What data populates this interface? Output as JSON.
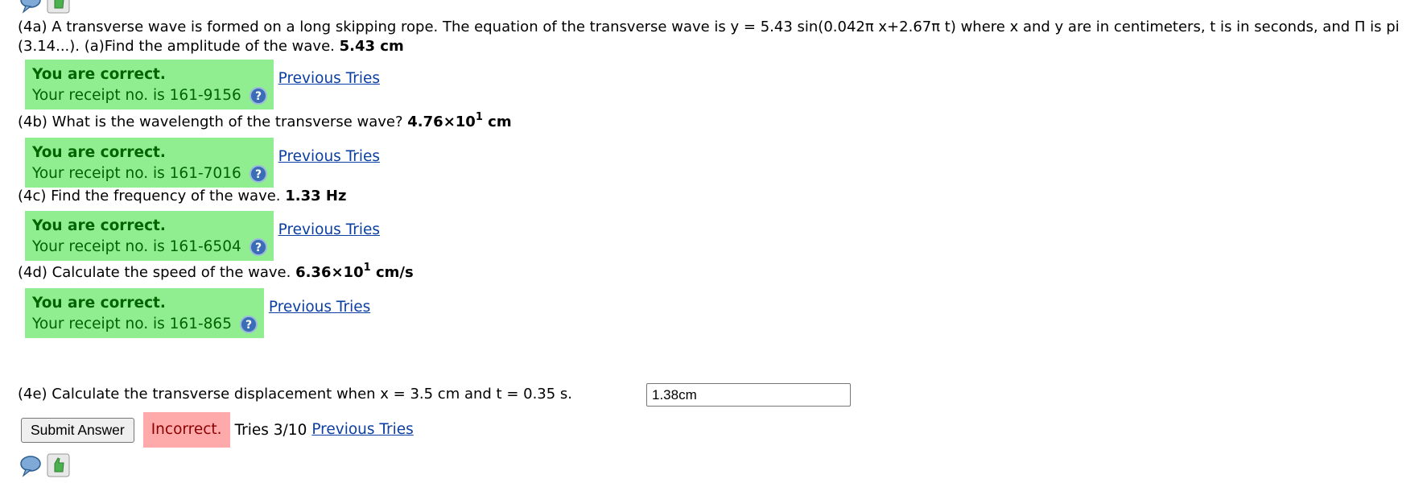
{
  "colors": {
    "correct_bg": "#90ee90",
    "correct_text": "#006400",
    "incorrect_bg": "#ffaaaa",
    "incorrect_text": "#8b0000",
    "link": "#0b3fa3"
  },
  "icons": {
    "discussion": "speech-bubble-icon",
    "feedback": "thumbs-up-icon",
    "help": "help-question-icon"
  },
  "q4a": {
    "text": "(4a) A transverse wave is formed on a long skipping rope. The equation of the transverse wave is y = 5.43 sin(0.042π x+2.67π t) where x and y are in centimeters, t is in seconds, and Π is pi (3.14...). (a)Find the amplitude of the wave.",
    "answer": "5.43 cm",
    "status_title": "You are correct.",
    "receipt": "Your receipt no. is 161-9156",
    "prev_tries": "Previous Tries"
  },
  "q4b": {
    "text": "(4b) What is the wavelength of the transverse wave?",
    "answer_mantissa": "4.76×10",
    "answer_exp": "1",
    "answer_unit": "cm",
    "status_title": "You are correct.",
    "receipt": "Your receipt no. is 161-7016",
    "prev_tries": "Previous Tries"
  },
  "q4c": {
    "text": "(4c) Find the frequency of the wave.",
    "answer": "1.33 Hz",
    "status_title": "You are correct.",
    "receipt": "Your receipt no. is 161-6504",
    "prev_tries": "Previous Tries"
  },
  "q4d": {
    "text": "(4d) Calculate the speed of the wave.",
    "answer_mantissa": "6.36×10",
    "answer_exp": "1",
    "answer_unit": "cm/s",
    "status_title": "You are correct.",
    "receipt": "Your receipt no. is 161-865",
    "prev_tries": "Previous Tries"
  },
  "q4e": {
    "text": "(4e) Calculate the transverse displacement when x = 3.5 cm and t = 0.35 s.",
    "input_value": "1.38cm",
    "submit_label": "Submit Answer",
    "result": "Incorrect.",
    "tries": "Tries 3/10",
    "prev_tries": "Previous Tries"
  }
}
